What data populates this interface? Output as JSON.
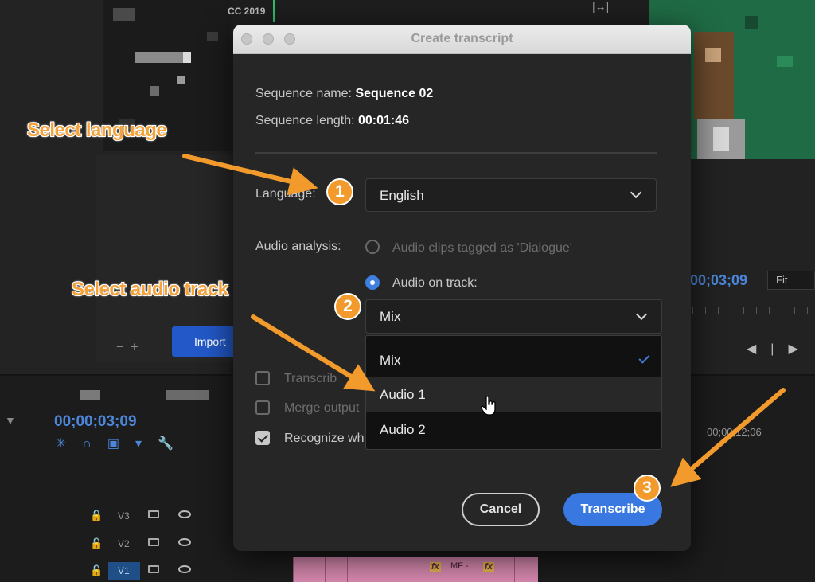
{
  "background": {
    "version_label": "CC 2019",
    "program_timecode": "00;03;09",
    "fit_label": "Fit",
    "import_label": "Import",
    "timeline_timecode": "00;00;03;09",
    "timeline_ruler_time": "00;00;12;06",
    "tracks": [
      "V3",
      "V2",
      "V1"
    ],
    "clip_label": "MF -",
    "fx_label": "fx"
  },
  "dialog": {
    "title": "Create transcript",
    "sequence_name_label": "Sequence name:",
    "sequence_name_value": "Sequence 02",
    "sequence_length_label": "Sequence length:",
    "sequence_length_value": "00:01:46",
    "language_label": "Language:",
    "language_value": "English",
    "audio_analysis_label": "Audio analysis:",
    "radio_dialogue_label": "Audio clips tagged as 'Dialogue'",
    "radio_track_label": "Audio on track:",
    "track_value": "Mix",
    "track_options": [
      "Mix",
      "Audio 1",
      "Audio 2"
    ],
    "checkbox_transcribe_label": "Transcrib",
    "checkbox_merge_label": "Merge output",
    "checkbox_recognize_label": "Recognize wh",
    "cancel_label": "Cancel",
    "transcribe_label": "Transcribe"
  },
  "annotations": {
    "select_language": "Select language",
    "select_audio_track": "Select audio track",
    "badges": [
      "1",
      "2",
      "3"
    ],
    "accent_color": "#f39a2c"
  }
}
